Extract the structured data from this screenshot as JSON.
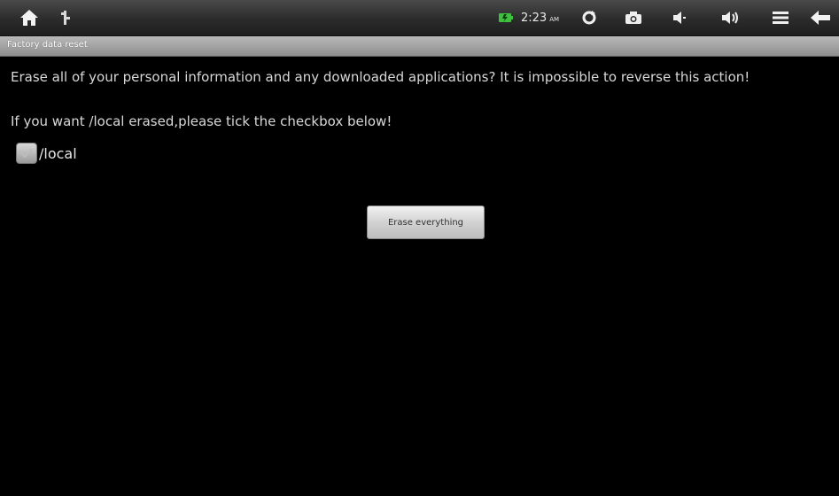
{
  "status_bar": {
    "time": "2:23",
    "ampm": "AM",
    "icons": [
      "home-icon",
      "usb-icon",
      "battery-icon",
      "refresh-icon",
      "camera-icon",
      "volume-down-icon",
      "volume-up-icon",
      "menu-icon",
      "back-icon"
    ]
  },
  "title": "Factory data reset",
  "message": "Erase all of your personal information and any downloaded applications? It is impossible to reverse this action!",
  "instruction": "If you want /local erased,please tick the checkbox below!",
  "checkbox": {
    "label": "/local",
    "checked": false
  },
  "erase_button": {
    "label": "Erase everything"
  },
  "colors": {
    "background": "#000000",
    "text": "#d8d8d8",
    "battery_green": "#3fbf3f"
  }
}
